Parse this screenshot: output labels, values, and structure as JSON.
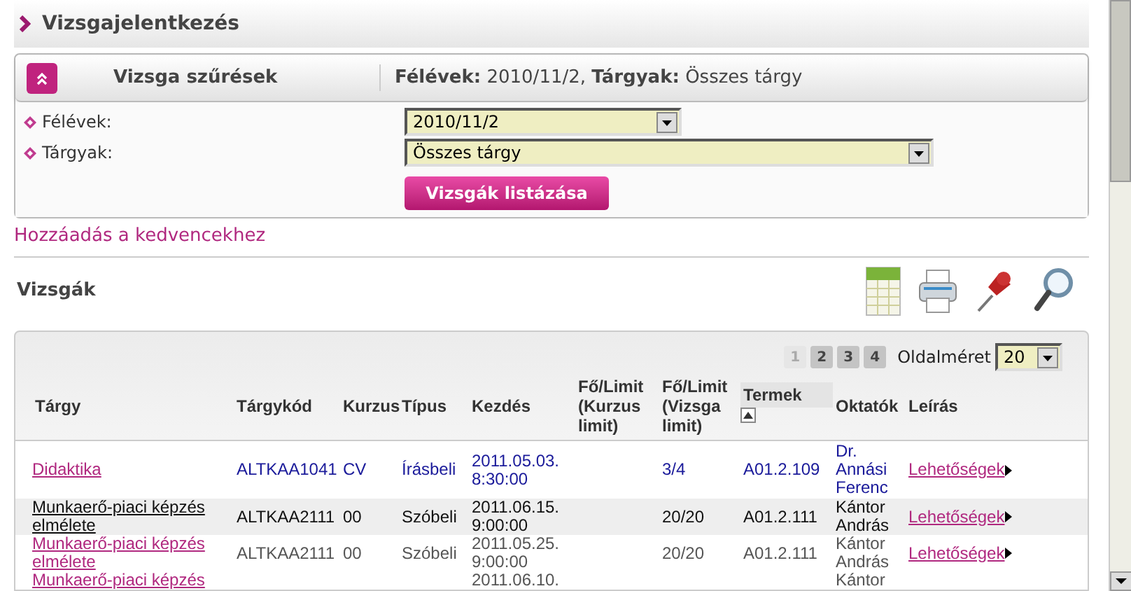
{
  "page_title": "Vizsgajelentkezés",
  "filter": {
    "title": "Vizsga szűrések",
    "summary": "**Félévek:** 2010/11/2, **Tárgyak:** Összes tárgy",
    "expanded": true,
    "fields": [
      {
        "label": "Félévek:",
        "value": "2010/11/2"
      },
      {
        "label": "Tárgyak:",
        "value": "Összes tárgy"
      }
    ],
    "button": "Vizsgák listázása"
  },
  "favorite_link": "Hozzáadás a kedvencekhez",
  "section_title": "Vizsgák",
  "pager": {
    "pages": [
      {
        "label": "1",
        "selected": true
      },
      {
        "label": "2",
        "selected": false
      },
      {
        "label": "3",
        "selected": false
      },
      {
        "label": "4",
        "selected": false
      }
    ],
    "page_size_label": "Oldalméret",
    "page_size": "20"
  },
  "table": {
    "columns": [
      "Tárgy",
      "Tárgykód",
      "Kurzus",
      "Típus",
      "Kezdés",
      "Fő/Limit (Kurzus limit)",
      "Fő/Limit (Vizsga limit)",
      "Termek",
      "Oktatók",
      "Leírás"
    ],
    "rows": [
      {
        "kind": "registered",
        "cells": [
          "Didaktika",
          "ALTKAA1041",
          "CV",
          "Írásbeli",
          "2011.05.03. 8:30:00",
          "",
          "3/4",
          "A01.2.109",
          "Dr. Annási Ferenc",
          "Lehetőségek"
        ]
      },
      {
        "kind": "highlighted",
        "cells": [
          "Munkaerő-piaci képzés elmélete",
          "ALTKAA2111",
          "00",
          "Szóbeli",
          "2011.06.15. 9:00:00",
          "",
          "20/20",
          "A01.2.111",
          "Kántor András",
          "Lehetőségek"
        ]
      },
      {
        "kind": "normal",
        "cells": [
          "Munkaerő-piaci képzés elmélete",
          "ALTKAA2111",
          "00",
          "Szóbeli",
          "2011.05.25. 9:00:00",
          "",
          "20/20",
          "A01.2.111",
          "Kántor András",
          "Lehetőségek"
        ]
      },
      {
        "kind": "normal",
        "cells": [
          "Munkaerő-piaci képzés",
          "",
          "",
          "",
          "2011.06.10.",
          "",
          "",
          "",
          "Kántor",
          ""
        ]
      }
    ]
  }
}
